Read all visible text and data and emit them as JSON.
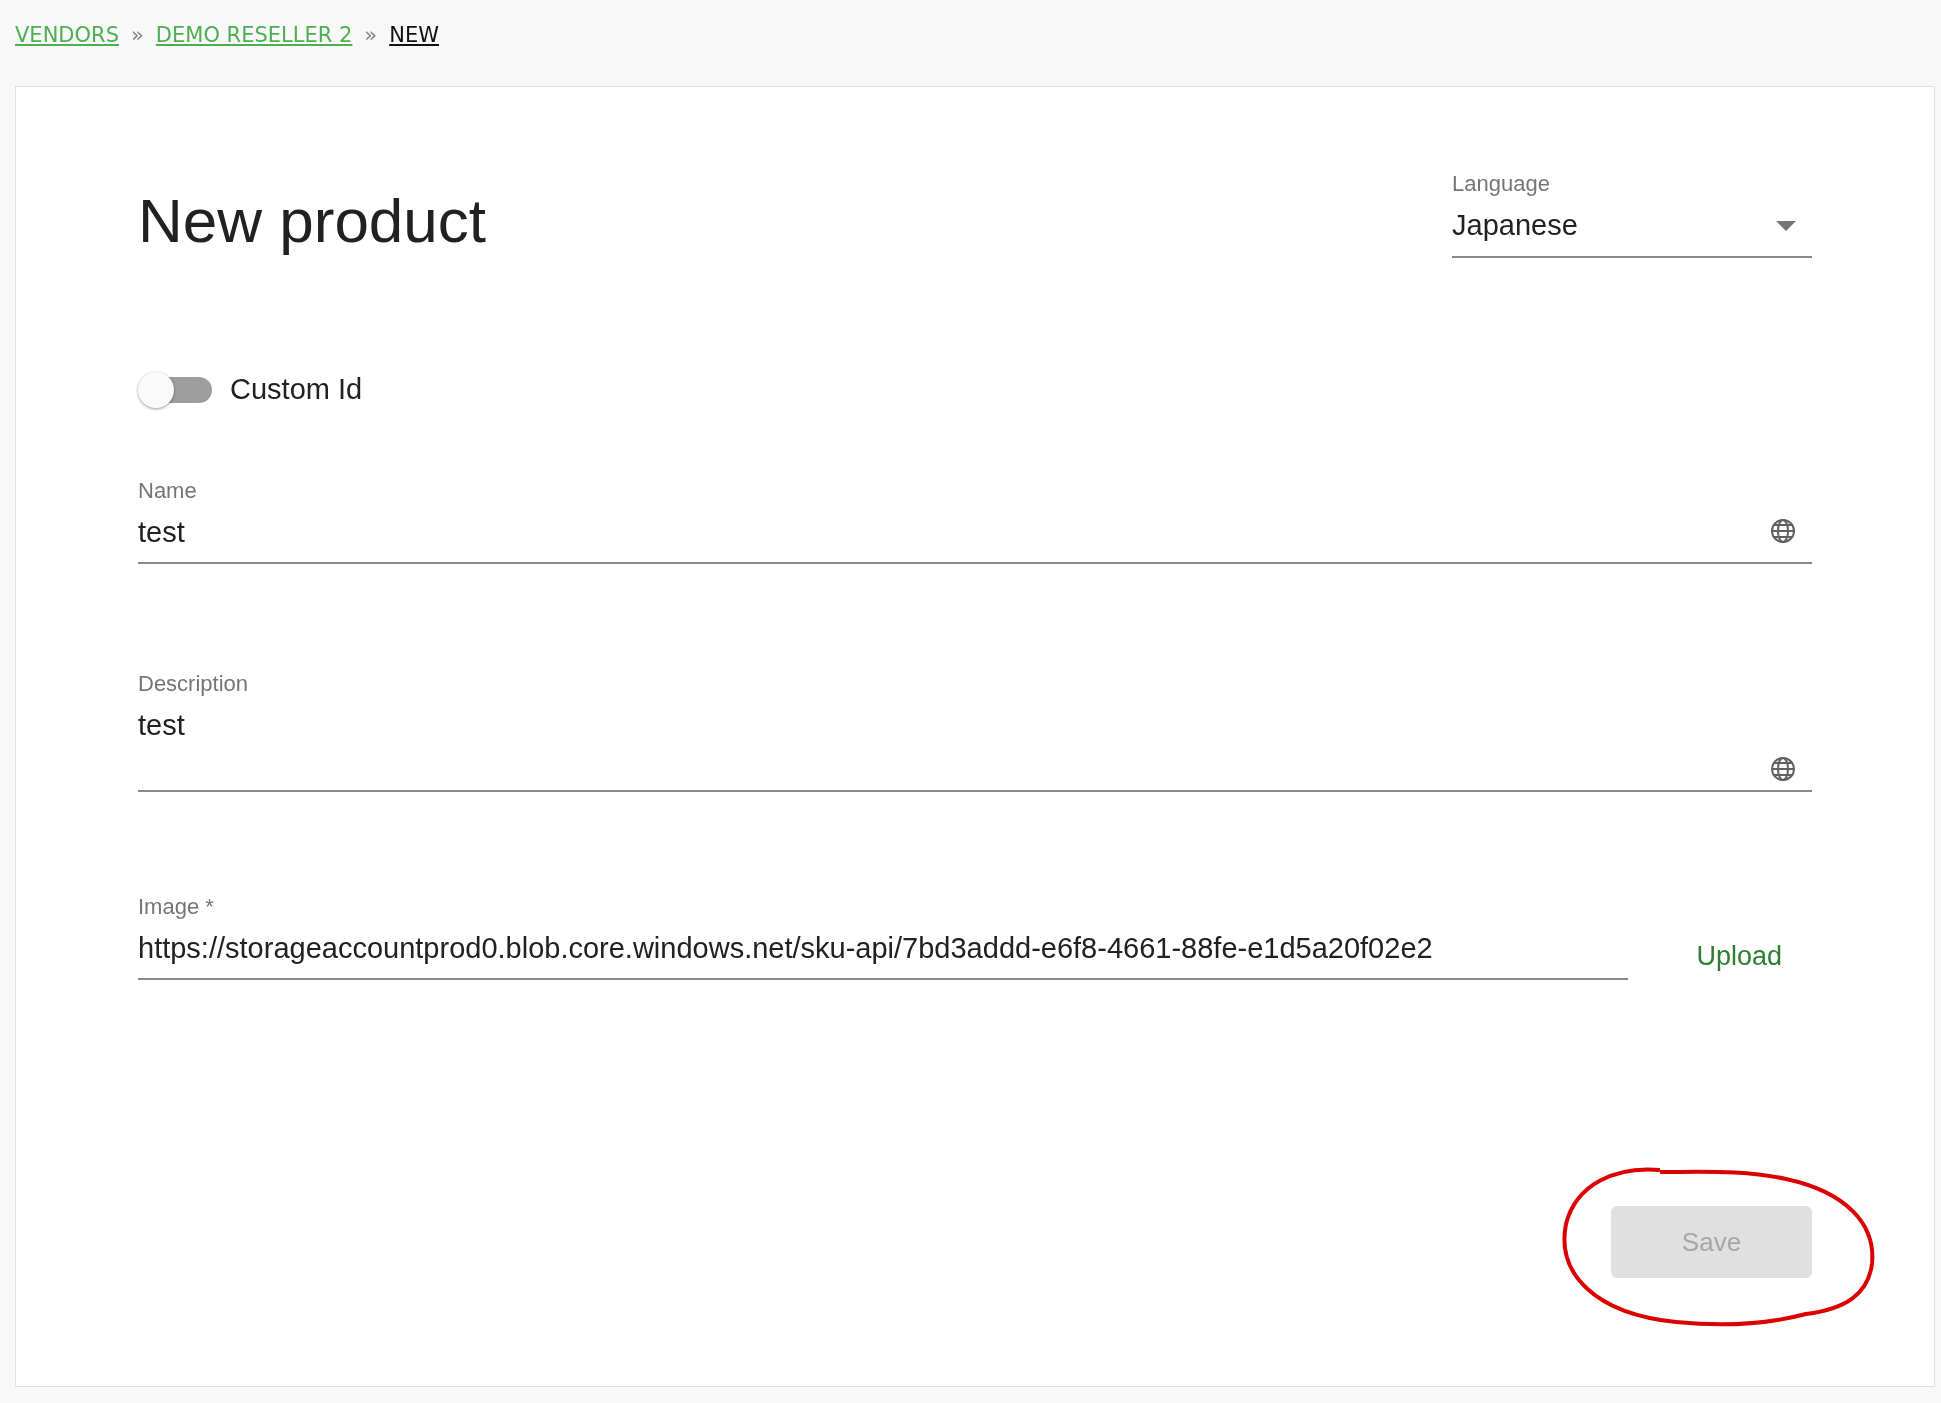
{
  "breadcrumb": [
    {
      "label": "VENDORS",
      "kind": "link"
    },
    {
      "label": "»",
      "kind": "separator"
    },
    {
      "label": "DEMO RESELLER 2",
      "kind": "link"
    },
    {
      "label": "»",
      "kind": "separator"
    },
    {
      "label": "NEW",
      "kind": "current"
    }
  ],
  "title": "New product",
  "language": {
    "label": "Language",
    "value": "Japanese"
  },
  "custom_id": {
    "label": "Custom Id",
    "on": false
  },
  "fields": [
    {
      "label": "Name",
      "value": "test",
      "kind": "line"
    },
    {
      "label": "Description",
      "value": "test",
      "kind": "multiline"
    }
  ],
  "image": {
    "label": "Image *",
    "value": "https://storageaccountprod0.blob.core.windows.net/sku-api/7bd3addd-e6f8-4661-88fe-e1d5a20f02e2",
    "button": "Upload"
  },
  "save_button": {
    "label": "Save",
    "disabled": true
  }
}
